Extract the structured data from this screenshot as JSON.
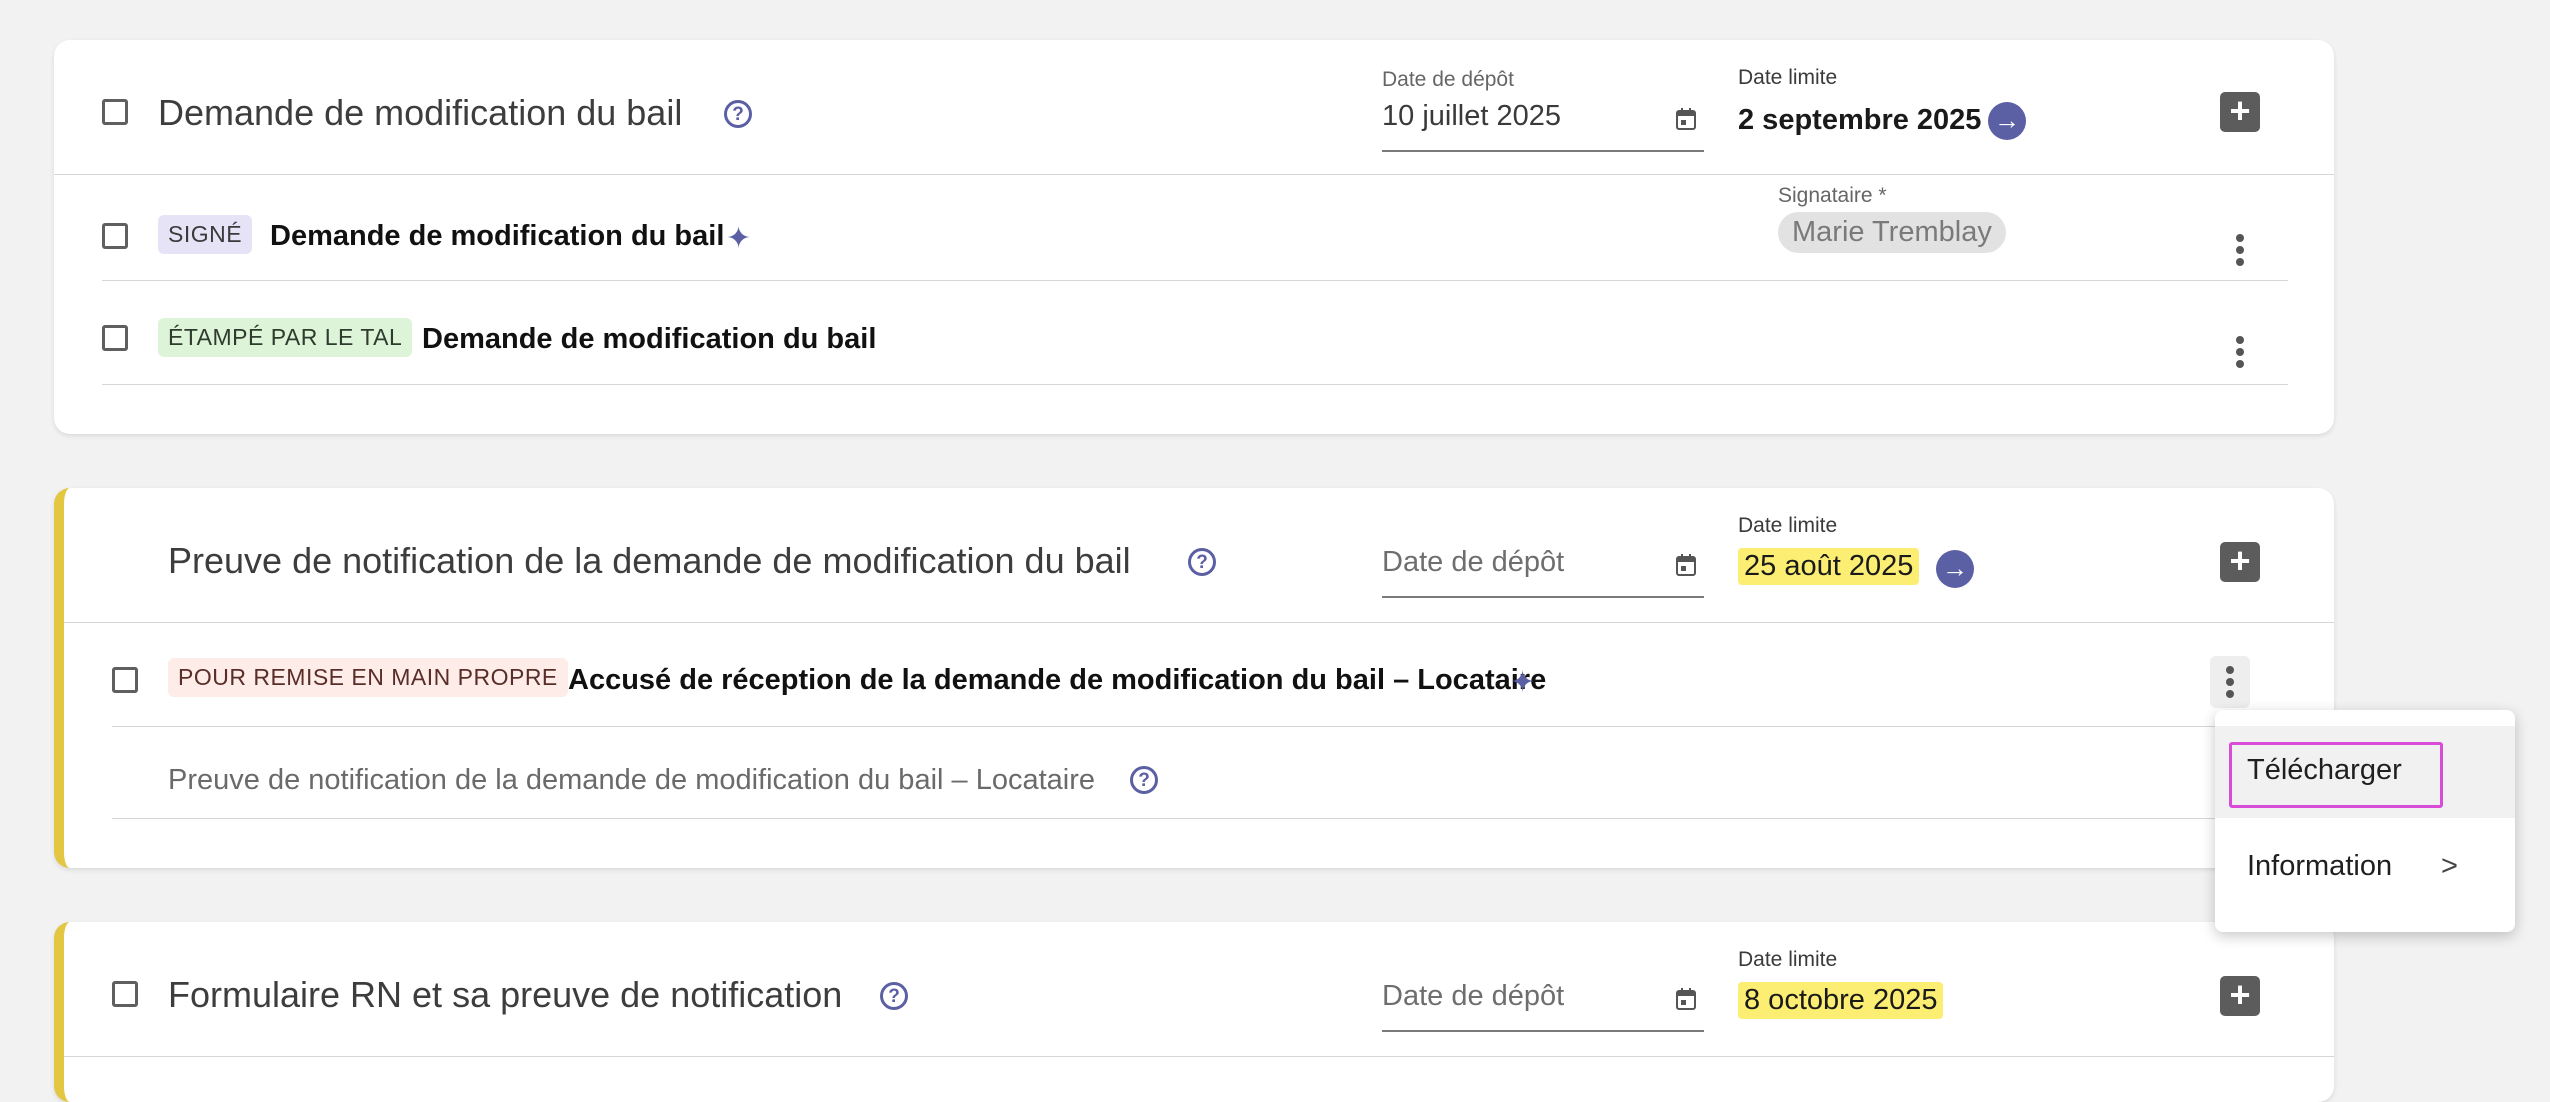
{
  "sections": [
    {
      "title": "Demande de modification du bail",
      "deposit_label": "Date de dépôt",
      "deposit_value": "10 juillet 2025",
      "deadline_label": "Date limite",
      "deadline_value": "2 septembre 2025",
      "documents": [
        {
          "badge": "SIGNÉ",
          "title": "Demande de modification du bail",
          "signer_label": "Signataire *",
          "signer_value": "Marie Tremblay"
        },
        {
          "badge": "ÉTAMPÉ PAR LE TAL",
          "title": "Demande de modification du bail"
        }
      ]
    },
    {
      "title": "Preuve de notification de la demande de modification du bail",
      "deposit_placeholder": "Date de dépôt",
      "deadline_label": "Date limite",
      "deadline_value": "25 août 2025",
      "documents": [
        {
          "badge": "POUR REMISE EN MAIN PROPRE",
          "title": "Accusé de réception de la demande de modification du bail – Locataire"
        }
      ],
      "pending_item": "Preuve de notification de la demande de modification du bail – Locataire"
    },
    {
      "title": "Formulaire RN et sa preuve de notification",
      "deposit_placeholder": "Date de dépôt",
      "deadline_label": "Date limite",
      "deadline_value": "8 octobre 2025"
    }
  ],
  "context_menu": {
    "items": [
      {
        "label": "Télécharger"
      },
      {
        "label": "Information",
        "chevron": ">"
      }
    ]
  },
  "icons": {
    "help": "?",
    "arrow": "→",
    "plus": "+",
    "sparkle": "✦"
  },
  "colors": {
    "accent": "#5b5fa3",
    "highlight": "#fbee73",
    "section_marker": "#e3c742",
    "focus_outline": "#d84dd8"
  }
}
